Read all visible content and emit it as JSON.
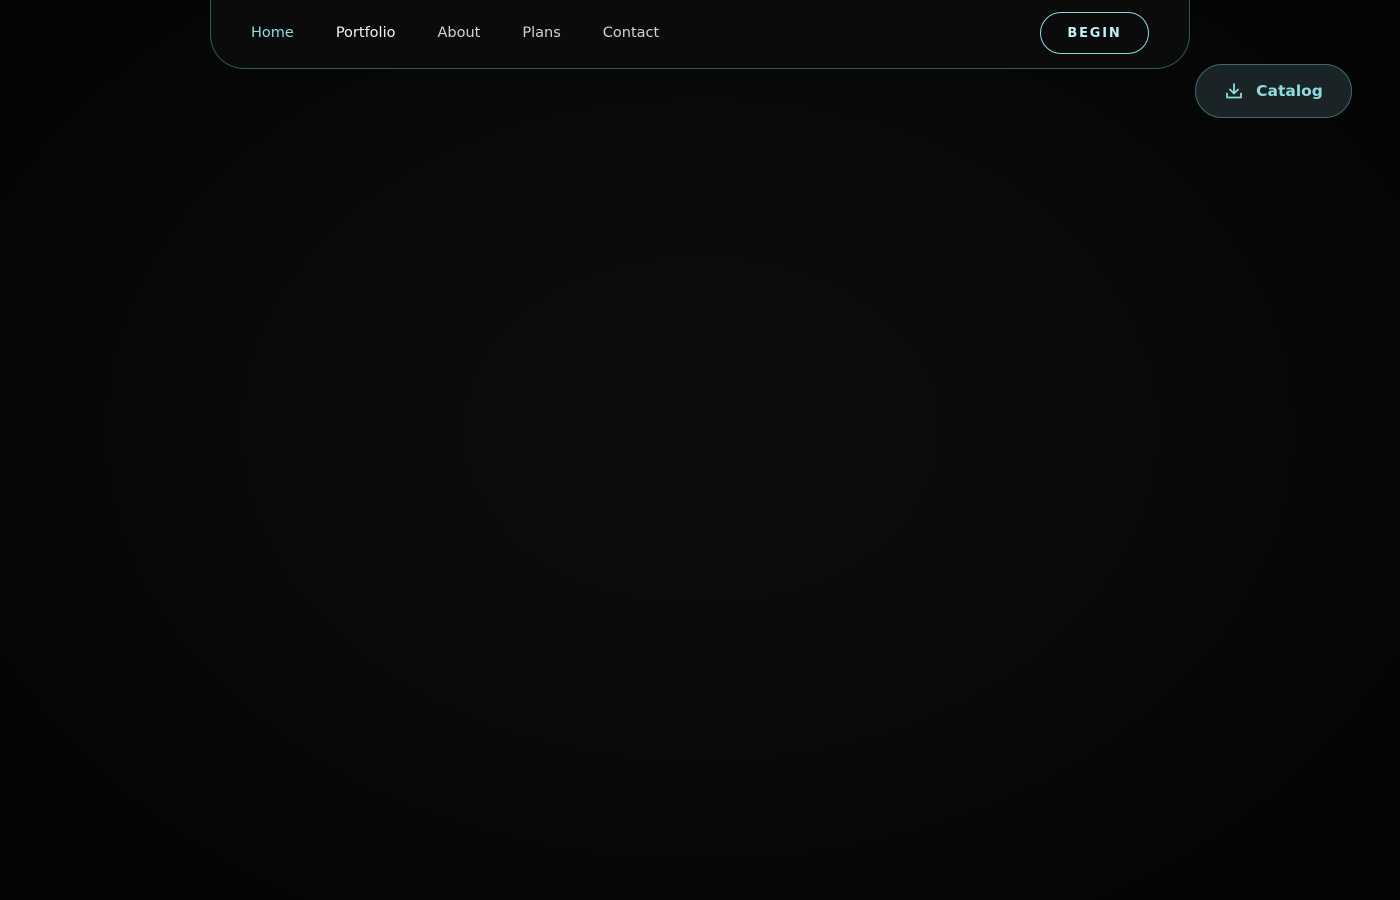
{
  "nav": {
    "links": [
      {
        "label": "Home"
      },
      {
        "label": "Portfolio"
      },
      {
        "label": "About"
      },
      {
        "label": "Plans"
      },
      {
        "label": "Contact"
      }
    ],
    "cta_label": "BEGIN"
  },
  "catalog": {
    "label": "Catalog",
    "icon": "download-icon"
  },
  "colors": {
    "accent": "#8fdbe0",
    "background": "#070707",
    "border": "#2e5a5a"
  }
}
